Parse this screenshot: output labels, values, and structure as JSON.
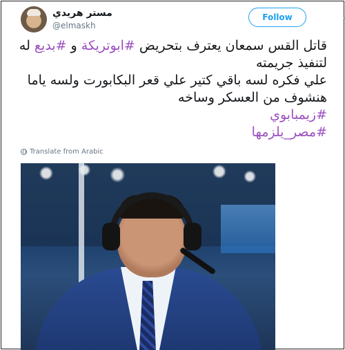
{
  "user": {
    "display_name": "مستر هريدي",
    "handle": "@elmaskh"
  },
  "follow_label": "Follow",
  "tweet": {
    "lines": [
      [
        {
          "text": "قاتل القس سمعان يعترف بتحريض ",
          "tag": false
        },
        {
          "text": "#ابوتريكة",
          "tag": true
        },
        {
          "text": " و ",
          "tag": false
        },
        {
          "text": "#بديع",
          "tag": true
        },
        {
          "text": " له",
          "tag": false
        }
      ],
      [
        {
          "text": "لتنفيذ جريمته",
          "tag": false
        }
      ],
      [
        {
          "text": "علي فكره لسه باقي كتير علي قعر البكابورت ولسه ياما",
          "tag": false
        }
      ],
      [
        {
          "text": "هنشوف من العسكر وساخه",
          "tag": false
        }
      ],
      [
        {
          "text": "#زيمبابوي",
          "tag": true
        }
      ],
      [
        {
          "text": "#مصر_يلزمها",
          "tag": true
        }
      ]
    ]
  },
  "translate_label": "Translate from Arabic",
  "colors": {
    "hashtag": "#9b4fbf",
    "follow": "#1da1f2",
    "secondary_text": "#657786"
  },
  "icons": {
    "translate": "globe-icon",
    "menu": "chevron-down-icon"
  }
}
